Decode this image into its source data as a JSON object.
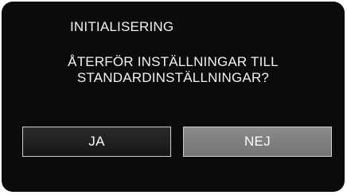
{
  "dialog": {
    "title": "INITIALISERING",
    "question_line1": "ÅTERFÖR INSTÄLLNINGAR TILL",
    "question_line2": "STANDARDINSTÄLLNINGAR?",
    "buttons": {
      "yes_label": "JA",
      "no_label": "NEJ",
      "selected": "NEJ"
    }
  },
  "colors": {
    "background": "#0b0b0b",
    "text": "#f2f2f2",
    "button_default": "#222222",
    "button_selected": "#808080"
  }
}
